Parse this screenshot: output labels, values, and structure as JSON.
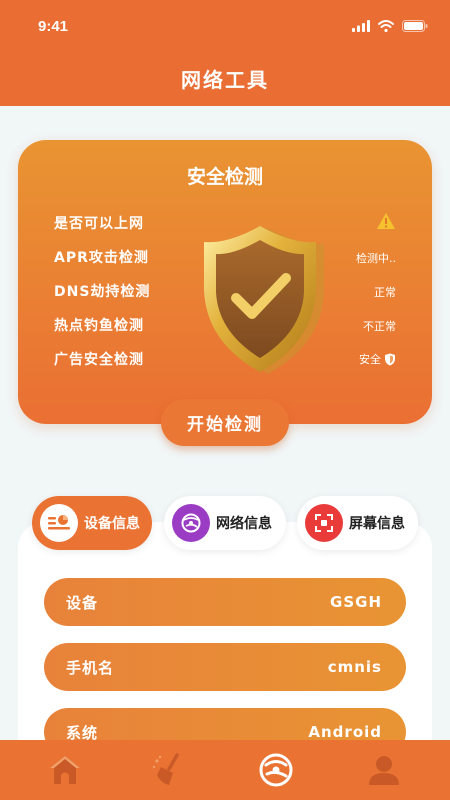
{
  "status_bar": {
    "time": "9:41"
  },
  "header": {
    "title": "网络工具"
  },
  "security_card": {
    "title": "安全检测",
    "items": [
      {
        "label": "是否可以上网",
        "status": "",
        "status_icon": "warning-icon"
      },
      {
        "label": "APR攻击检测",
        "status": "检测中.."
      },
      {
        "label": "DNS劫持检测",
        "status": "正常"
      },
      {
        "label": "热点钓鱼检测",
        "status": "不正常"
      },
      {
        "label": "广告安全检测",
        "status": "安全",
        "status_icon": "shield-small-icon"
      }
    ],
    "start_button": "开始检测"
  },
  "tabs": [
    {
      "label": "设备信息",
      "icon": "device-info-icon",
      "active": true
    },
    {
      "label": "网络信息",
      "icon": "network-info-icon",
      "active": false
    },
    {
      "label": "屏幕信息",
      "icon": "screen-info-icon",
      "active": false
    }
  ],
  "device_info": [
    {
      "key": "设备",
      "value": "GSGH"
    },
    {
      "key": "手机名",
      "value": "cmnis"
    },
    {
      "key": "系统",
      "value": "Android"
    }
  ],
  "bottom_nav": [
    {
      "icon": "home-icon"
    },
    {
      "icon": "clean-icon"
    },
    {
      "icon": "network-tool-icon"
    },
    {
      "icon": "profile-icon"
    }
  ],
  "colors": {
    "primary": "#ea6e33",
    "accent": "#e99433",
    "background": "#f1f6f7",
    "warning": "#f5c12e"
  }
}
